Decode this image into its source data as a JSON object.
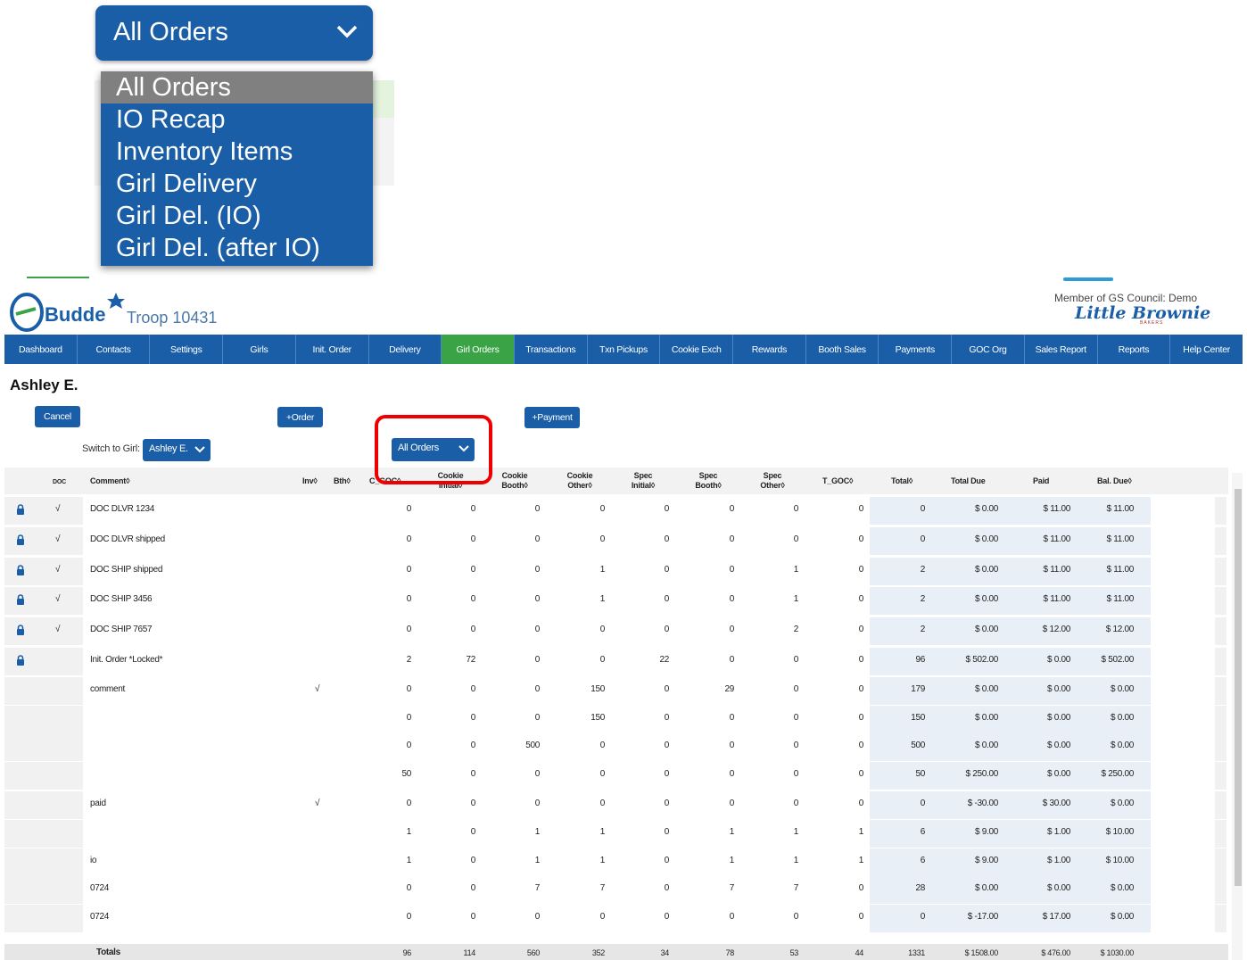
{
  "zoom_callout": {
    "selected": "All Orders",
    "options": [
      "All Orders",
      "IO Recap",
      "Inventory Items",
      "Girl Delivery",
      "Girl Del. (IO)",
      "Girl Del. (after IO)"
    ]
  },
  "header": {
    "logo_text": "Budde",
    "troop": "Troop 10431",
    "member": "Member of GS Council: Demo",
    "brand": "Little Brownie",
    "brand_sub": "BAKERS"
  },
  "nav": [
    "Dashboard",
    "Contacts",
    "Settings",
    "Girls",
    "Init. Order",
    "Delivery",
    "Girl Orders",
    "Transactions",
    "Txn Pickups",
    "Cookie Exch",
    "Rewards",
    "Booth Sales",
    "Payments",
    "GOC Org",
    "Sales Report",
    "Reports",
    "Help Center"
  ],
  "nav_active": "Girl Orders",
  "page": {
    "girl_name": "Ashley E.",
    "cancel_label": "Cancel",
    "order_label": "+Order",
    "payment_label": "+Payment",
    "switch_label": "Switch to Girl:",
    "switch_value": "Ashley E.",
    "filter_value": "All Orders"
  },
  "table": {
    "headers": {
      "doc": "DOC",
      "comment": "Comment◊",
      "inv": "Inv◊",
      "bth": "Bth◊",
      "cgoc": "C_GOC◊",
      "cookie_initial": "Cookie Initial◊",
      "cookie_booth": "Cookie Booth◊",
      "cookie_other": "Cookie Other◊",
      "spec_initial": "Spec Initial◊",
      "spec_booth": "Spec Booth◊",
      "spec_other": "Spec Other◊",
      "tgoc": "T_GOC◊",
      "total": "Total◊",
      "total_due": "Total Due",
      "paid": "Paid",
      "bal_due": "Bal. Due◊"
    },
    "rows": [
      {
        "lock": true,
        "doc": "√",
        "comment": "DOC DLVR 1234",
        "inv": "",
        "c": [
          "0",
          "0",
          "0",
          "0",
          "0",
          "0",
          "0",
          "0"
        ],
        "total": "0",
        "due": "$ 0.00",
        "paid": "$ 11.00",
        "bal": "$ 11.00"
      },
      {
        "lock": true,
        "doc": "√",
        "comment": "DOC DLVR shipped",
        "inv": "",
        "c": [
          "0",
          "0",
          "0",
          "0",
          "0",
          "0",
          "0",
          "0"
        ],
        "total": "0",
        "due": "$ 0.00",
        "paid": "$ 11.00",
        "bal": "$ 11.00"
      },
      {
        "lock": true,
        "doc": "√",
        "comment": "DOC SHIP shipped",
        "inv": "",
        "c": [
          "0",
          "0",
          "0",
          "1",
          "0",
          "0",
          "1",
          "0"
        ],
        "total": "2",
        "due": "$ 0.00",
        "paid": "$ 11.00",
        "bal": "$ 11.00"
      },
      {
        "lock": true,
        "doc": "√",
        "comment": "DOC SHIP 3456",
        "inv": "",
        "c": [
          "0",
          "0",
          "0",
          "1",
          "0",
          "0",
          "1",
          "0"
        ],
        "total": "2",
        "due": "$ 0.00",
        "paid": "$ 11.00",
        "bal": "$ 11.00"
      },
      {
        "lock": true,
        "doc": "√",
        "comment": "DOC SHIP 7657",
        "inv": "",
        "c": [
          "0",
          "0",
          "0",
          "0",
          "0",
          "0",
          "2",
          "0"
        ],
        "total": "2",
        "due": "$ 0.00",
        "paid": "$ 12.00",
        "bal": "$ 12.00"
      },
      {
        "lock": true,
        "doc": "",
        "comment": "Init. Order *Locked*",
        "inv": "",
        "c": [
          "2",
          "72",
          "0",
          "0",
          "22",
          "0",
          "0",
          "0"
        ],
        "total": "96",
        "due": "$ 502.00",
        "paid": "$ 0.00",
        "bal": "$ 502.00"
      },
      {
        "lock": false,
        "doc": "",
        "comment": "comment",
        "inv": "√",
        "c": [
          "0",
          "0",
          "0",
          "150",
          "0",
          "29",
          "0",
          "0"
        ],
        "total": "179",
        "due": "$ 0.00",
        "paid": "$ 0.00",
        "bal": "$ 0.00"
      },
      {
        "lock": false,
        "doc": "",
        "comment": "",
        "inv": "",
        "c": [
          "0",
          "0",
          "0",
          "150",
          "0",
          "0",
          "0",
          "0"
        ],
        "total": "150",
        "due": "$ 0.00",
        "paid": "$ 0.00",
        "bal": "$ 0.00"
      },
      {
        "lock": false,
        "doc": "",
        "comment": "",
        "inv": "",
        "c": [
          "0",
          "0",
          "500",
          "0",
          "0",
          "0",
          "0",
          "0"
        ],
        "total": "500",
        "due": "$ 0.00",
        "paid": "$ 0.00",
        "bal": "$ 0.00"
      },
      {
        "lock": false,
        "doc": "",
        "comment": "",
        "inv": "",
        "c": [
          "50",
          "0",
          "0",
          "0",
          "0",
          "0",
          "0",
          "0"
        ],
        "total": "50",
        "due": "$ 250.00",
        "paid": "$ 0.00",
        "bal": "$ 250.00"
      },
      {
        "lock": false,
        "doc": "",
        "comment": "paid",
        "inv": "√",
        "c": [
          "0",
          "0",
          "0",
          "0",
          "0",
          "0",
          "0",
          "0"
        ],
        "total": "0",
        "due": "$ -30.00",
        "paid": "$ 30.00",
        "bal": "$ 0.00"
      },
      {
        "lock": false,
        "doc": "",
        "comment": "",
        "inv": "",
        "c": [
          "1",
          "0",
          "1",
          "1",
          "0",
          "1",
          "1",
          "1"
        ],
        "total": "6",
        "due": "$ 9.00",
        "paid": "$ 1.00",
        "bal": "$ 10.00"
      },
      {
        "lock": false,
        "doc": "",
        "comment": "io",
        "inv": "",
        "c": [
          "1",
          "0",
          "1",
          "1",
          "0",
          "1",
          "1",
          "1"
        ],
        "total": "6",
        "due": "$ 9.00",
        "paid": "$ 1.00",
        "bal": "$ 10.00"
      },
      {
        "lock": false,
        "doc": "",
        "comment": "0724",
        "inv": "",
        "c": [
          "0",
          "0",
          "7",
          "7",
          "0",
          "7",
          "7",
          "0"
        ],
        "total": "28",
        "due": "$ 0.00",
        "paid": "$ 0.00",
        "bal": "$ 0.00"
      },
      {
        "lock": false,
        "doc": "",
        "comment": "0724",
        "inv": "",
        "c": [
          "0",
          "0",
          "0",
          "0",
          "0",
          "0",
          "0",
          "0"
        ],
        "total": "0",
        "due": "$ -17.00",
        "paid": "$ 17.00",
        "bal": "$ 0.00"
      }
    ],
    "totals": {
      "label": "Totals",
      "c": [
        "96",
        "114",
        "560",
        "352",
        "34",
        "78",
        "53",
        "44"
      ],
      "total": "1331",
      "due": "$ 1508.00",
      "paid": "$ 476.00",
      "bal": "$ 1030.00"
    }
  },
  "colors": {
    "primary": "#1a5ea8",
    "active_tab": "#3aa346",
    "highlight": "#e00000"
  }
}
